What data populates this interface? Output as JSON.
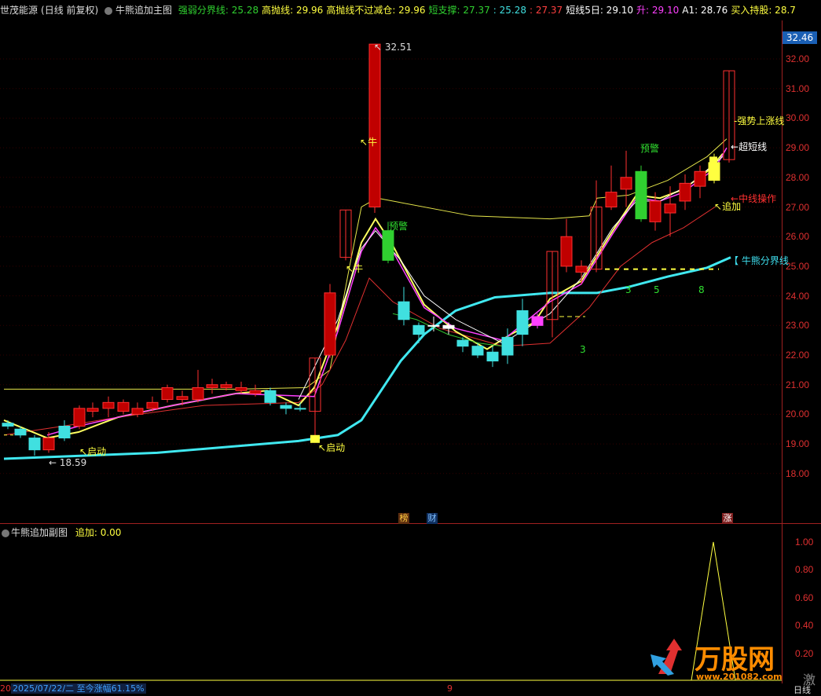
{
  "header": {
    "stock_name": "世茂能源",
    "period": "(日线 前复权)",
    "indicator_name": "牛熊追加主图",
    "items": [
      {
        "label": "强弱分界线:",
        "value": "25.28",
        "color": "#30d030"
      },
      {
        "label": "高抛线:",
        "value": "29.96",
        "color": "#ffff40"
      },
      {
        "label": "高抛线不过减仓:",
        "value": "29.96",
        "color": "#ffff40"
      },
      {
        "label": "短支撑:",
        "value": "27.37",
        "color": "#30d030"
      },
      {
        "label": "",
        "value": ": 25.28",
        "color": "#40e0e0"
      },
      {
        "label": "",
        "value": ": 27.37",
        "color": "#ff4040"
      },
      {
        "label": "短线5日:",
        "value": "29.10",
        "color": "#ffffff"
      },
      {
        "label": "升:",
        "value": "29.10",
        "color": "#ff40ff"
      },
      {
        "label": "A1:",
        "value": "28.76",
        "color": "#ffffff"
      },
      {
        "label": "买入持股:",
        "value": "28.7",
        "color": "#ffff40"
      }
    ]
  },
  "price_box": "32.46",
  "y_ticks": [
    "32.00",
    "31.00",
    "30.00",
    "29.00",
    "28.00",
    "27.00",
    "26.00",
    "25.00",
    "24.00",
    "23.00",
    "22.00",
    "21.00",
    "20.00",
    "19.00",
    "18.00"
  ],
  "chart_labels": {
    "high_price": "32.51",
    "low_price": "18.59",
    "niu1": "牛",
    "niu2": "牛",
    "start1": "启动",
    "start2": "启动",
    "alert1": "预警",
    "alert2": "预警",
    "add1": "追加",
    "strong_up": "强势上涨线",
    "super_short": "超短线",
    "mid_op": "中线操作",
    "bull_bear": "【 牛熊分界线",
    "count_3a": "3",
    "count_3b": "3",
    "count_5": "5",
    "count_8": "8",
    "badge_bang": "榜",
    "badge_cai": "财",
    "badge_zhang": "涨"
  },
  "sub": {
    "title": "牛熊追加副图",
    "label": "追加:",
    "value": "0.00",
    "ticks": [
      "1.00",
      "0.80",
      "0.60",
      "0.40",
      "0.20"
    ]
  },
  "status": {
    "left_num": "20",
    "date_text": "2025/07/22/二  至今涨幅61.15%",
    "mid_num": "9",
    "right": "日线"
  },
  "watermark": {
    "brand": "万股网",
    "url": "www.201082.com",
    "side_char": "激"
  },
  "colors": {
    "up": "#ff3030",
    "down": "#40e0e0",
    "bull_bear": "#40e0f0",
    "yellow": "#ffff40",
    "magenta": "#ff40ff"
  }
}
